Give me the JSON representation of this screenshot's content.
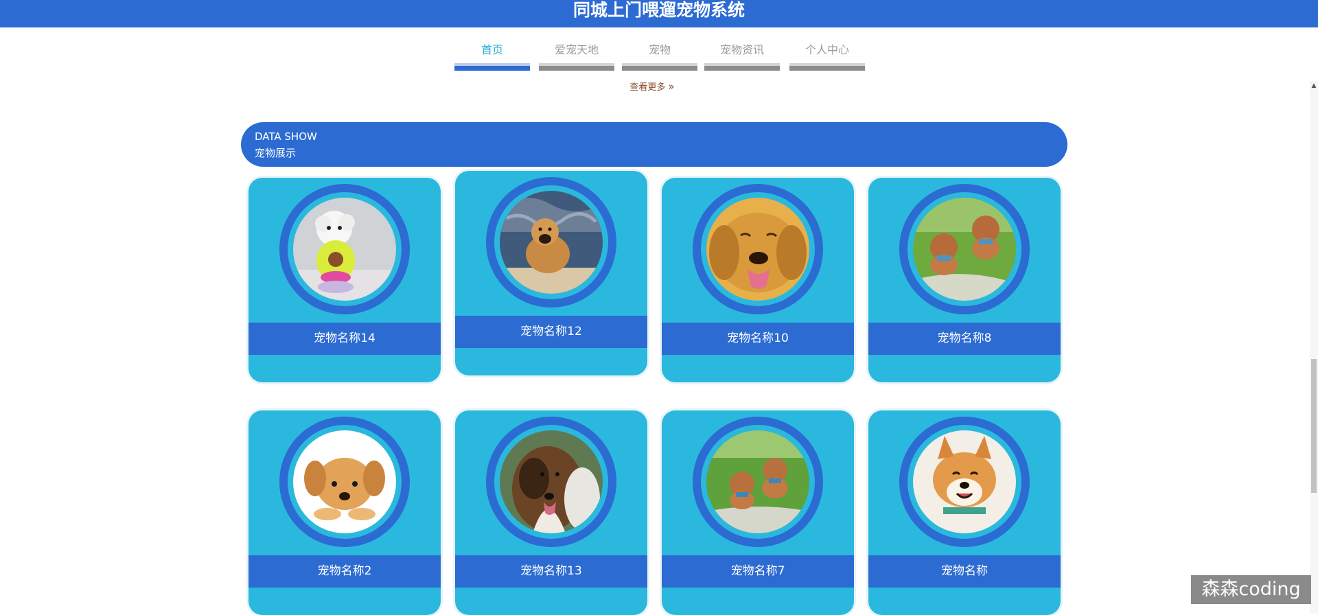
{
  "header": {
    "title": "同城上门喂遛宠物系统"
  },
  "nav": {
    "tabs": [
      {
        "label": "首页",
        "active": true
      },
      {
        "label": "爱宠天地",
        "active": false
      },
      {
        "label": "宠物",
        "active": false
      },
      {
        "label": "宠物资讯",
        "active": false
      },
      {
        "label": "个人中心",
        "active": false
      }
    ],
    "more_label": "查看更多"
  },
  "section": {
    "title_en": "DATA SHOW",
    "title_cn": "宠物展示"
  },
  "pets": [
    {
      "name": "宠物名称14",
      "photo": "white-poodle-in-costume"
    },
    {
      "name": "宠物名称12",
      "photo": "puppy-on-chair"
    },
    {
      "name": "宠物名称10",
      "photo": "golden-retriever"
    },
    {
      "name": "宠物名称8",
      "photo": "running-teddy-dogs"
    },
    {
      "name": "宠物名称2",
      "photo": "lying-puppy"
    },
    {
      "name": "宠物名称13",
      "photo": "collie"
    },
    {
      "name": "宠物名称7",
      "photo": "teddy-dogs-on-grass"
    },
    {
      "name": "宠物名称",
      "photo": "shiba-inu"
    }
  ],
  "watermark": "森森coding",
  "colors": {
    "primary": "#2c6bd2",
    "card": "#2bb8de",
    "active_tab": "#2bb0d8"
  }
}
